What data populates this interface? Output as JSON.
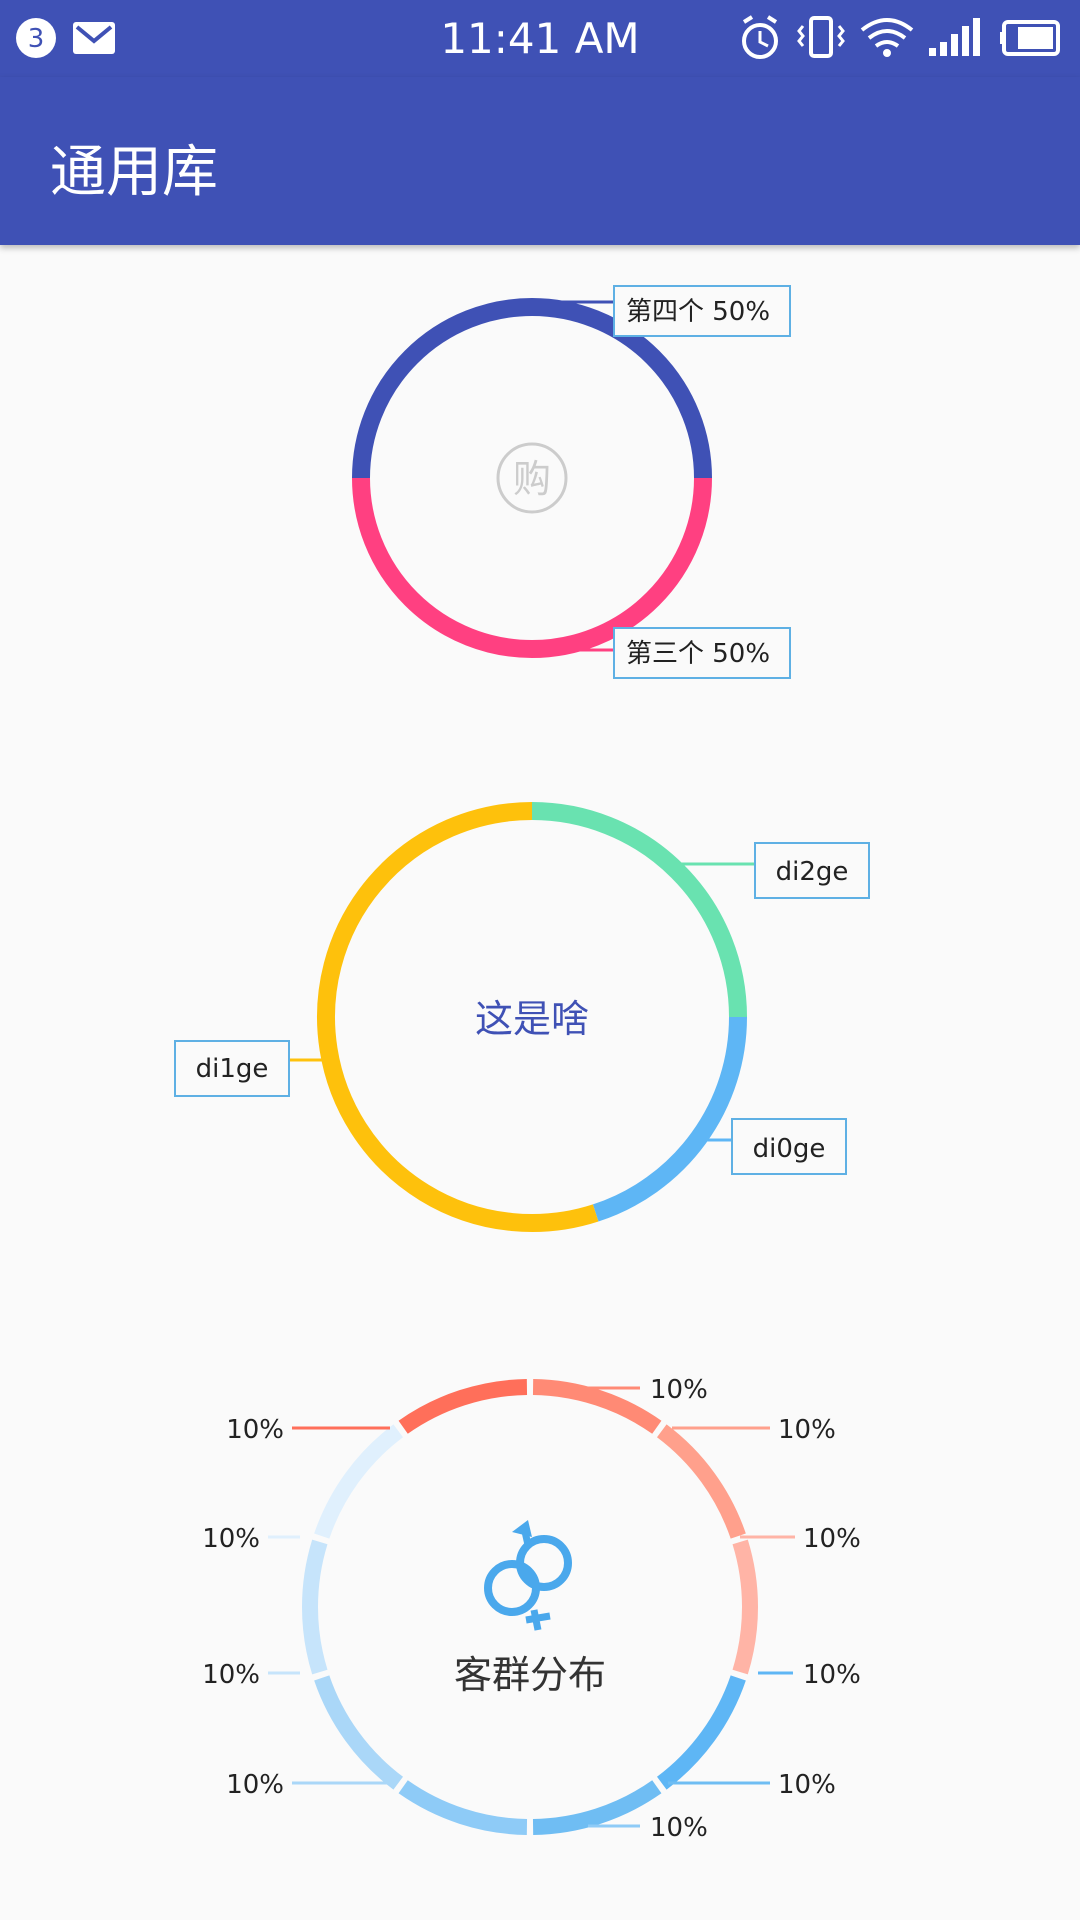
{
  "status_bar": {
    "notification_count": "3",
    "time": "11:41 AM",
    "icons": [
      "badge-icon",
      "mail-icon",
      "alarm-icon",
      "vibrate-icon",
      "wifi-icon",
      "signal-icon",
      "battery-icon"
    ]
  },
  "app_bar": {
    "title": "通用库"
  },
  "colors": {
    "primary": "#3f51b5",
    "pink": "#ff4081",
    "green": "#69e2b0",
    "blue": "#5eb6f5",
    "yellow": "#fec10c",
    "callout_border": "#5eb0e4"
  },
  "chart_data": [
    {
      "type": "pie",
      "variant": "donut",
      "center_icon": "shopping-bag-icon",
      "center_icon_text": "购",
      "series": [
        {
          "label": "第四个 50%",
          "value": 50,
          "color": "#3f51b5"
        },
        {
          "label": "第三个 50%",
          "value": 50,
          "color": "#ff4081"
        }
      ]
    },
    {
      "type": "pie",
      "variant": "donut",
      "center_text": "这是啥",
      "series": [
        {
          "label": "di2ge",
          "value": 25,
          "color": "#69e2b0"
        },
        {
          "label": "di0ge",
          "value": 20,
          "color": "#5eb6f5"
        },
        {
          "label": "di1ge",
          "value": 55,
          "color": "#fec10c"
        }
      ]
    },
    {
      "type": "pie",
      "variant": "donut",
      "center_icon": "gender-icon",
      "center_text": "客群分布",
      "series": [
        {
          "label": "10%",
          "value": 10,
          "color": "#ff8a75"
        },
        {
          "label": "10%",
          "value": 10,
          "color": "#ffa08c"
        },
        {
          "label": "10%",
          "value": 10,
          "color": "#ffb4a6"
        },
        {
          "label": "10%",
          "value": 10,
          "color": "#5eb6f5"
        },
        {
          "label": "10%",
          "value": 10,
          "color": "#6fbdf3"
        },
        {
          "label": "10%",
          "value": 10,
          "color": "#8ecbf7"
        },
        {
          "label": "10%",
          "value": 10,
          "color": "#aad7f8"
        },
        {
          "label": "10%",
          "value": 10,
          "color": "#c6e4fb"
        },
        {
          "label": "10%",
          "value": 10,
          "color": "#e0f0fd"
        },
        {
          "label": "10%",
          "value": 10,
          "color": "#ff6f5a"
        }
      ]
    }
  ]
}
